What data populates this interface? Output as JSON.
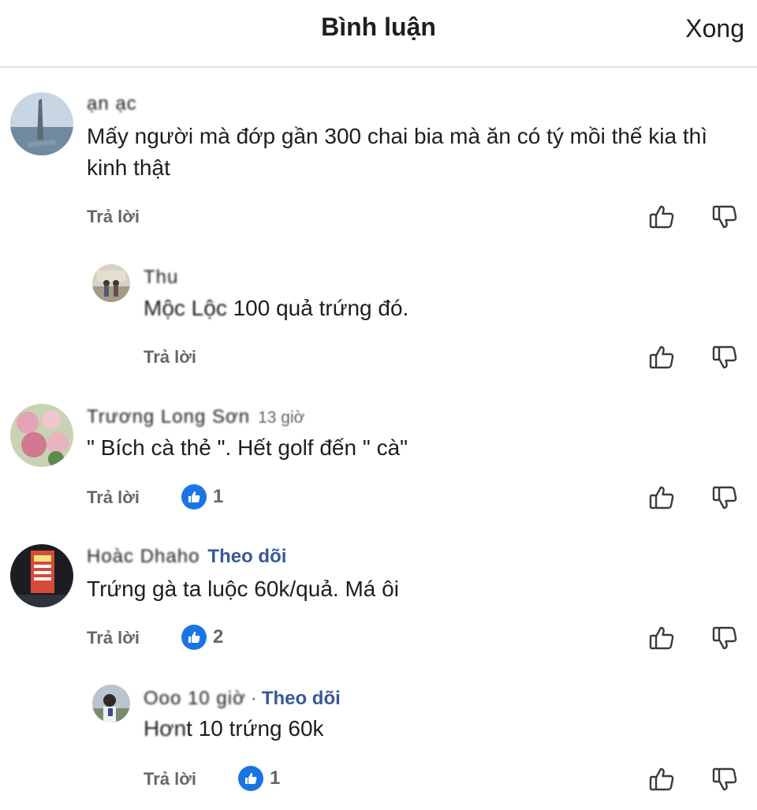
{
  "header": {
    "title": "Bình luận",
    "done_label": "Xong"
  },
  "comments": [
    {
      "name": "ạn  ạc",
      "meta": "",
      "follow": "",
      "text": "Mấy người mà đớp gần 300 chai bia mà ăn có tý mồi thế kia thì kinh thật",
      "text_prefix": "",
      "reply": "Trả lời",
      "likes": ""
    },
    {
      "name": "Thu",
      "meta": "",
      "follow": "",
      "text": " 100 quả trứng đó.",
      "text_prefix": "Mộc Lộc",
      "reply": "Trả lời",
      "likes": ""
    },
    {
      "name": "Trương Long Sơn",
      "meta": "13 giờ",
      "follow": "",
      "text": "\" Bích cà thẻ \". Hết golf đến \" cà\"",
      "text_prefix": "",
      "reply": "Trả lời",
      "likes": "1"
    },
    {
      "name": "Hoàc Dhaho",
      "meta": "",
      "follow": "Theo dõi",
      "text": "Trứng gà ta luộc 60k/quả. Má ôi",
      "text_prefix": "",
      "reply": "Trả lời",
      "likes": "2"
    },
    {
      "name": "Ooo 10 giờ",
      "meta": "",
      "follow": "Theo dõi",
      "text": "t 10 trứng 60k",
      "text_prefix": "Hơn",
      "reply": "Trả lời",
      "likes": "1"
    }
  ],
  "icons": {
    "like": "thumb-up-icon",
    "dislike": "thumb-down-icon",
    "badge": "like-badge-icon"
  },
  "colors": {
    "link": "#385898",
    "badge": "#1b74e4",
    "muted": "#65676b"
  }
}
